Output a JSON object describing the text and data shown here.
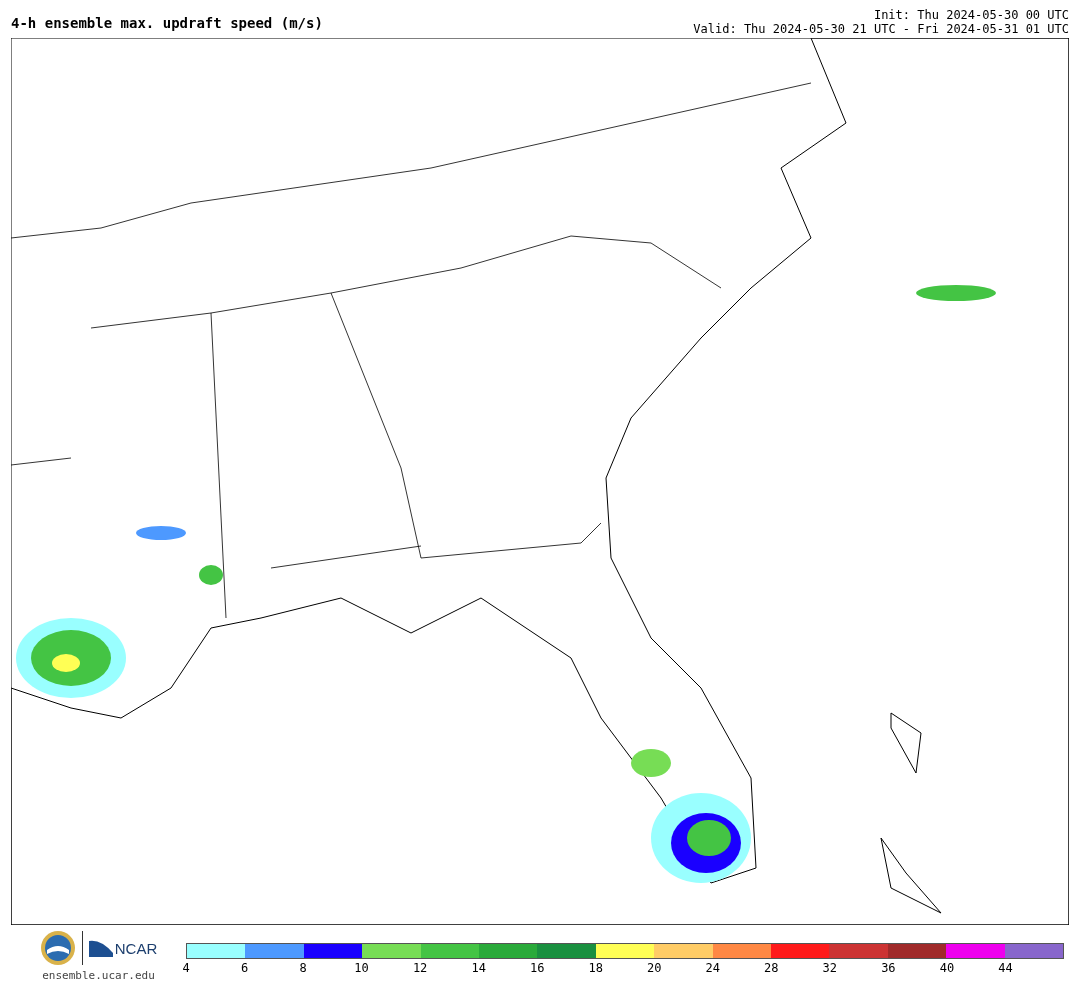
{
  "title": "4-h ensemble max. updraft speed (m/s)",
  "init": "Init: Thu 2024-05-30 00 UTC",
  "valid": "Valid: Thu 2024-05-30 21 UTC - Fri 2024-05-31 01 UTC",
  "logos": {
    "name": "NCAR",
    "site": "ensemble.ucar.edu"
  },
  "colorbar": [
    {
      "label": "4",
      "color": "#99ffff"
    },
    {
      "label": "6",
      "color": "#4d99ff"
    },
    {
      "label": "8",
      "color": "#1a00ff"
    },
    {
      "label": "10",
      "color": "#77dd55"
    },
    {
      "label": "12",
      "color": "#44c444"
    },
    {
      "label": "14",
      "color": "#2aaa3a"
    },
    {
      "label": "16",
      "color": "#1a9040"
    },
    {
      "label": "18",
      "color": "#ffff55"
    },
    {
      "label": "20",
      "color": "#ffcc66"
    },
    {
      "label": "24",
      "color": "#ff8844"
    },
    {
      "label": "28",
      "color": "#ff1a1a"
    },
    {
      "label": "32",
      "color": "#cc3333"
    },
    {
      "label": "36",
      "color": "#a02a2a"
    },
    {
      "label": "40",
      "color": "#ee00ee"
    },
    {
      "label": "44",
      "color": "#8866cc"
    }
  ]
}
